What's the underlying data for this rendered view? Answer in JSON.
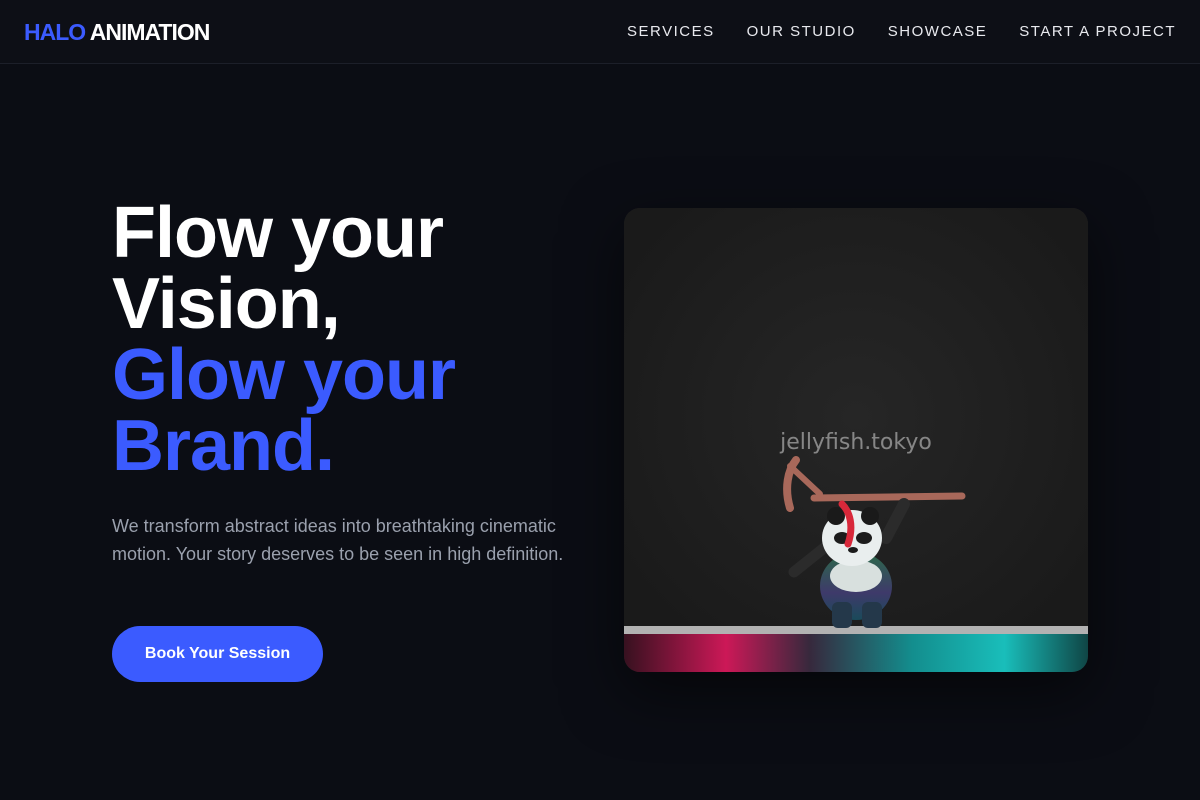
{
  "brand": {
    "name_accent": "HALO",
    "name_rest": "ANIMATION"
  },
  "nav": {
    "links": [
      {
        "label": "SERVICES"
      },
      {
        "label": "OUR STUDIO"
      },
      {
        "label": "SHOWCASE"
      },
      {
        "label": "START A PROJECT"
      }
    ]
  },
  "hero": {
    "headline_line1": "Flow your",
    "headline_line2": "Vision,",
    "headline_line3": "Glow your",
    "headline_line4": "Brand.",
    "subtext": "We transform abstract ideas into breathtaking cinematic motion. Your story deserves to be seen in high definition.",
    "cta_label": "Book Your Session"
  },
  "media": {
    "watermark": "jellyfish.tokyo"
  },
  "colors": {
    "accent": "#3b5bff",
    "background": "#0b0d14",
    "subtext": "#9aa0ad"
  }
}
